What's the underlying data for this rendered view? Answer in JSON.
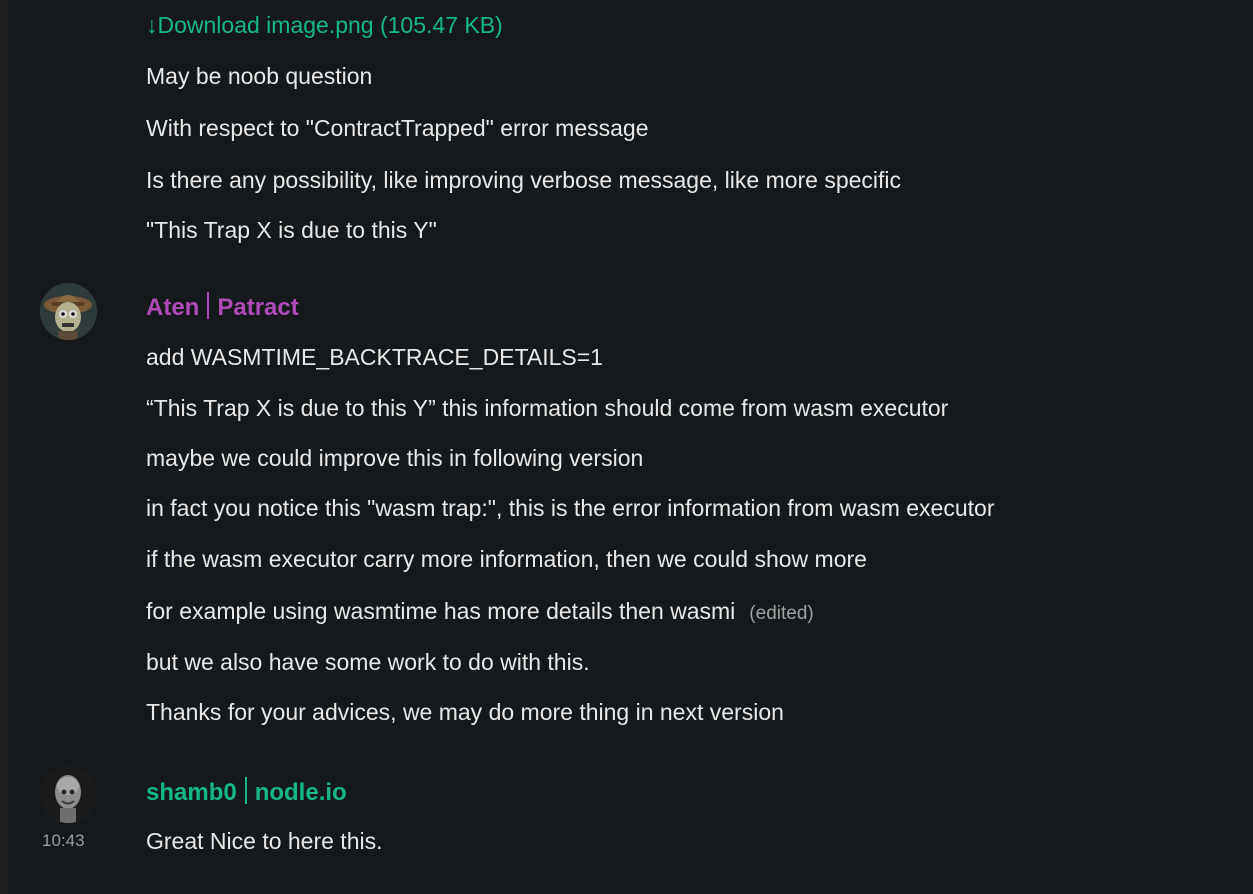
{
  "attachment": {
    "download_label": "↓Download image.png (105.47 KB)"
  },
  "messages_prev": {
    "lines": [
      "May be noob question",
      "With respect to \"ContractTrapped\" error message",
      "Is there any possibility, like improving verbose message, like more specific",
      "\"This Trap X is due to this Y\""
    ]
  },
  "message_aten": {
    "user_name": "Aten",
    "user_org": "Patract",
    "lines": [
      "add WASMTIME_BACKTRACE_DETAILS=1",
      "“This Trap X is due to this Y” this information should come from wasm executor",
      "maybe we could improve this in following version",
      "in fact you notice this \"wasm trap:\", this is the error information from wasm executor",
      "if the wasm executor carry more information, then we could show more",
      "for example using wasmtime has more details then wasmi",
      "but we also have some work to do with this.",
      "Thanks for your advices, we may do more thing in next version"
    ],
    "edited_label": "(edited)"
  },
  "message_shamb": {
    "user_name": "shamb0",
    "user_org": "nodle.io",
    "time": "10:43",
    "text": "Great Nice to here this."
  },
  "colors": {
    "background": "#15191c",
    "link": "#14b885",
    "user_aten": "#b04ab8",
    "user_shamb": "#14b885"
  }
}
